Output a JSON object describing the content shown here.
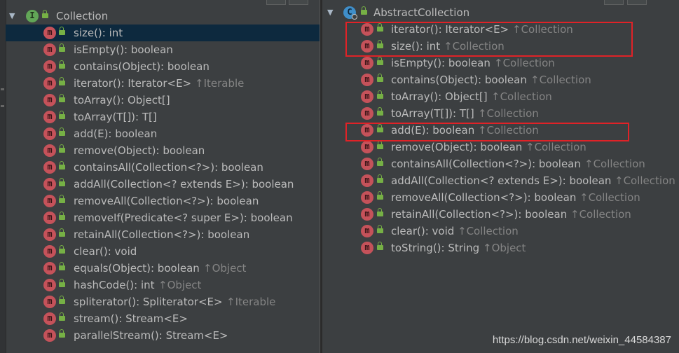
{
  "left": {
    "root": {
      "label": "Collection",
      "badge": "I"
    },
    "items": [
      {
        "sig": "size(): int",
        "inherited": "",
        "selected": true
      },
      {
        "sig": "isEmpty(): boolean",
        "inherited": ""
      },
      {
        "sig": "contains(Object): boolean",
        "inherited": ""
      },
      {
        "sig": "iterator(): Iterator<E>",
        "inherited": "↑Iterable"
      },
      {
        "sig": "toArray(): Object[]",
        "inherited": ""
      },
      {
        "sig": "toArray(T[]): T[]",
        "inherited": ""
      },
      {
        "sig": "add(E): boolean",
        "inherited": ""
      },
      {
        "sig": "remove(Object): boolean",
        "inherited": ""
      },
      {
        "sig": "containsAll(Collection<?>): boolean",
        "inherited": ""
      },
      {
        "sig": "addAll(Collection<? extends E>): boolean",
        "inherited": ""
      },
      {
        "sig": "removeAll(Collection<?>): boolean",
        "inherited": ""
      },
      {
        "sig": "removeIf(Predicate<? super E>): boolean",
        "inherited": ""
      },
      {
        "sig": "retainAll(Collection<?>): boolean",
        "inherited": ""
      },
      {
        "sig": "clear(): void",
        "inherited": ""
      },
      {
        "sig": "equals(Object): boolean",
        "inherited": "↑Object"
      },
      {
        "sig": "hashCode(): int",
        "inherited": "↑Object"
      },
      {
        "sig": "spliterator(): Spliterator<E>",
        "inherited": "↑Iterable"
      },
      {
        "sig": "stream(): Stream<E>",
        "inherited": ""
      },
      {
        "sig": "parallelStream(): Stream<E>",
        "inherited": ""
      }
    ]
  },
  "right": {
    "root": {
      "label": "AbstractCollection",
      "badge": "C"
    },
    "items": [
      {
        "sig": "iterator(): Iterator<E>",
        "inherited": "↑Collection"
      },
      {
        "sig": "size(): int",
        "inherited": "↑Collection"
      },
      {
        "sig": "isEmpty(): boolean",
        "inherited": "↑Collection"
      },
      {
        "sig": "contains(Object): boolean",
        "inherited": "↑Collection"
      },
      {
        "sig": "toArray(): Object[]",
        "inherited": "↑Collection"
      },
      {
        "sig": "toArray(T[]): T[]",
        "inherited": "↑Collection"
      },
      {
        "sig": "add(E): boolean",
        "inherited": "↑Collection"
      },
      {
        "sig": "remove(Object): boolean",
        "inherited": "↑Collection"
      },
      {
        "sig": "containsAll(Collection<?>): boolean",
        "inherited": "↑Collection"
      },
      {
        "sig": "addAll(Collection<? extends E>): boolean",
        "inherited": "↑Collection"
      },
      {
        "sig": "removeAll(Collection<?>): boolean",
        "inherited": "↑Collection"
      },
      {
        "sig": "retainAll(Collection<?>): boolean",
        "inherited": "↑Collection"
      },
      {
        "sig": "clear(): void",
        "inherited": "↑Collection"
      },
      {
        "sig": "toString(): String",
        "inherited": "↑Object"
      }
    ]
  },
  "watermark": "https://blog.csdn.net/weixin_44584387",
  "colors": {
    "background": "#3c3f41",
    "selection": "#0d293e",
    "method_badge": "#c5525a",
    "interface_badge": "#62a657",
    "class_badge": "#3f8ec9",
    "lock": "#76b045",
    "inherited_text": "#848484",
    "highlight_box": "#e02227"
  },
  "icons": {
    "expand": "triangle-down-icon",
    "method": "method-m-icon",
    "visibility": "public-lock-icon",
    "interface": "interface-i-icon",
    "class": "abstract-class-c-icon"
  }
}
